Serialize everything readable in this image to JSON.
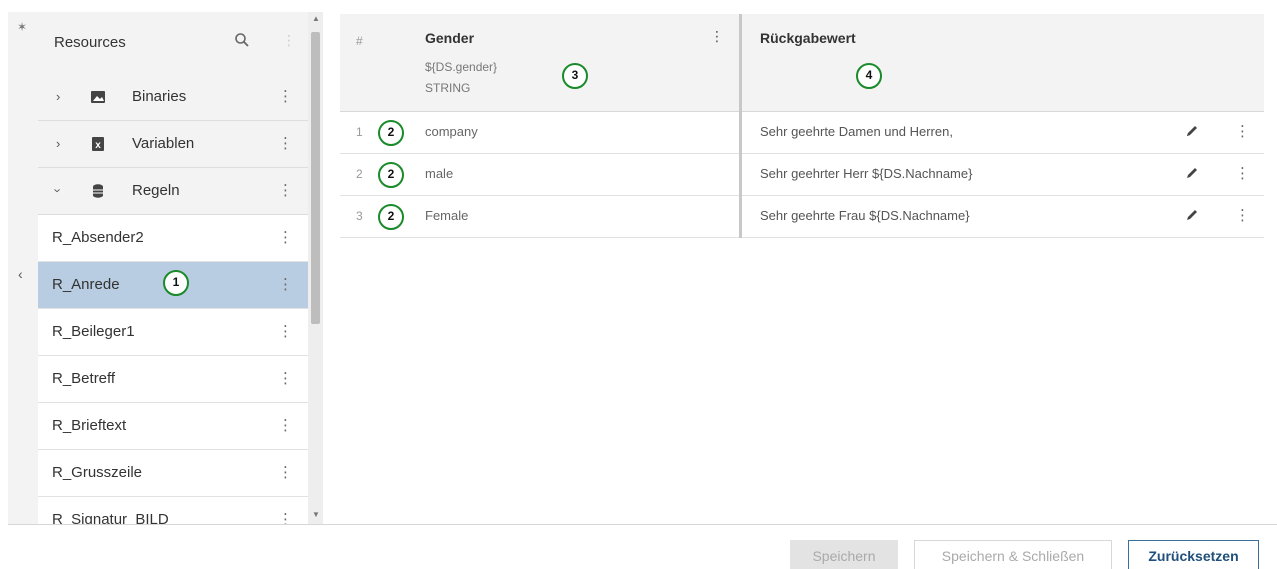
{
  "sidebar_strip": {
    "pin_icon": "pin-icon",
    "collapse_icon": "chevron-left-icon"
  },
  "resources": {
    "title": "Resources",
    "search_icon": "search-icon",
    "folders": [
      {
        "label": "Binaries",
        "expanded": false,
        "icon": "image-icon"
      },
      {
        "label": "Variablen",
        "expanded": false,
        "icon": "variable-icon"
      },
      {
        "label": "Regeln",
        "expanded": true,
        "icon": "database-icon"
      }
    ],
    "rules": [
      "R_Absender2",
      "R_Anrede",
      "R_Beileger1",
      "R_Betreff",
      "R_Brieftext",
      "R_Grusszeile",
      "R_Signatur_BILD"
    ],
    "selected_rule": "R_Anrede"
  },
  "table": {
    "num_header": "#",
    "gender_header": "Gender",
    "gender_expression": "${DS.gender}",
    "gender_type": "STRING",
    "return_header": "Rückgabewert",
    "rows": [
      {
        "num": "1",
        "value": "company",
        "return": "Sehr geehrte Damen und Herren,"
      },
      {
        "num": "2",
        "value": "male",
        "return": "Sehr geehrter Herr ${DS.Nachname}"
      },
      {
        "num": "3",
        "value": "Female",
        "return": "Sehr geehrte Frau ${DS.Nachname}"
      }
    ]
  },
  "annotations": {
    "selected_rule": "1",
    "row_marker": "2",
    "condition_column": "3",
    "return_column": "4"
  },
  "footer": {
    "save": "Speichern",
    "save_close": "Speichern & Schließen",
    "reset": "Zurücksetzen"
  },
  "colors": {
    "selected_row": "#b8cde1",
    "annotation": "#1a8a2a",
    "primary_button": "#3c6e9a"
  }
}
